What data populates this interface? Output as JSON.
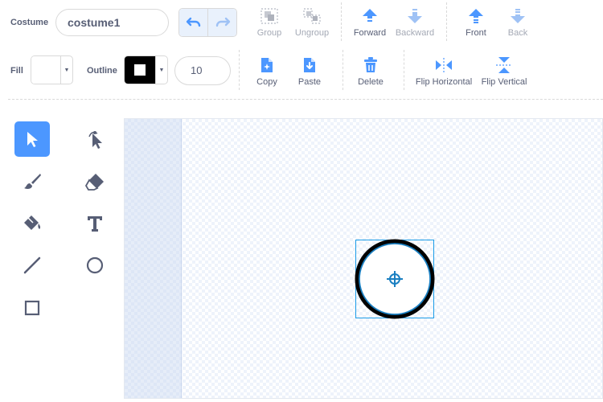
{
  "costume": {
    "label": "Costume",
    "name_value": "costume1"
  },
  "arrange": {
    "group": "Group",
    "ungroup": "Ungroup",
    "forward": "Forward",
    "backward": "Backward",
    "front": "Front",
    "back": "Back"
  },
  "fill": {
    "label": "Fill",
    "color": "#ffffff"
  },
  "outline": {
    "label": "Outline",
    "color": "#000000",
    "width_value": "10"
  },
  "edit": {
    "copy": "Copy",
    "paste": "Paste",
    "delete": "Delete",
    "flip_horizontal": "Flip Horizontal",
    "flip_vertical": "Flip Vertical"
  },
  "tools": [
    "select-icon",
    "reshape-icon",
    "brush-icon",
    "eraser-icon",
    "fill-icon",
    "text-icon",
    "line-icon",
    "circle-icon",
    "rectangle-icon"
  ],
  "colors": {
    "accent": "#4c97ff",
    "text": "#575e75",
    "disabled": "#a4a9b5",
    "delete_red": "#4c97ff",
    "selection": "#1a9ce8",
    "shape_stroke": "#000000",
    "shape_inner_stroke": "#1a7fc1"
  }
}
